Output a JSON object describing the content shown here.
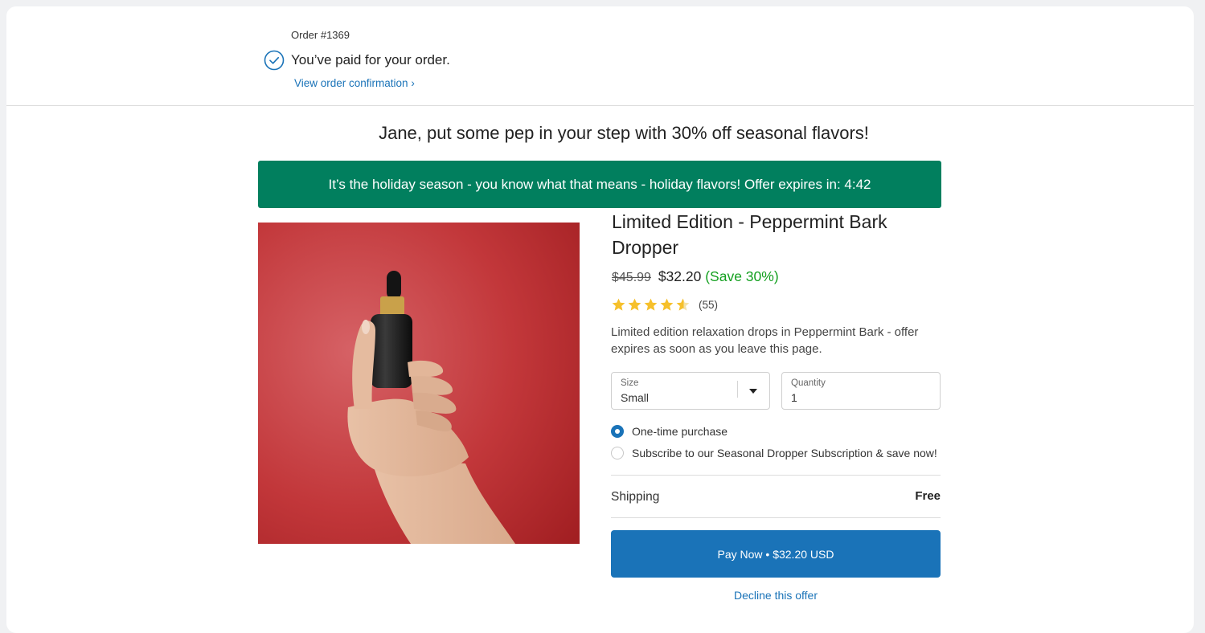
{
  "order": {
    "number_label": "Order #1369",
    "paid_message": "You’ve paid for your order.",
    "confirmation_link": "View order confirmation ›"
  },
  "promo": {
    "headline": "Jane, put some pep in your step with 30% off seasonal flavors!",
    "banner": "It’s the holiday season - you know what that means - holiday flavors! Offer expires in: 4:42"
  },
  "product": {
    "title": "Limited Edition - Peppermint Bark Dropper",
    "original_price": "$45.99",
    "sale_price": "$32.20",
    "savings": "(Save 30%)",
    "rating": 4.5,
    "review_count": "(55)",
    "description": "Limited edition relaxation drops in Peppermint Bark - offer expires as soon as you leave this page.",
    "image_icon": "dropper-bottle-in-hand-photo"
  },
  "options": {
    "size_label": "Size",
    "size_value": "Small",
    "quantity_label": "Quantity",
    "quantity_value": "1",
    "purchase_types": [
      {
        "label": "One-time purchase",
        "selected": true
      },
      {
        "label": "Subscribe to our Seasonal Dropper Subscription & save now!",
        "selected": false
      }
    ]
  },
  "shipping": {
    "label": "Shipping",
    "value": "Free"
  },
  "actions": {
    "pay_label": "Pay Now • $32.20 USD",
    "decline_label": "Decline this offer"
  },
  "colors": {
    "banner_green": "#017f5e",
    "primary_blue": "#1a73b8",
    "save_green": "#14a020",
    "star_gold": "#f6c02b",
    "photo_background_red": "#c2373a"
  }
}
